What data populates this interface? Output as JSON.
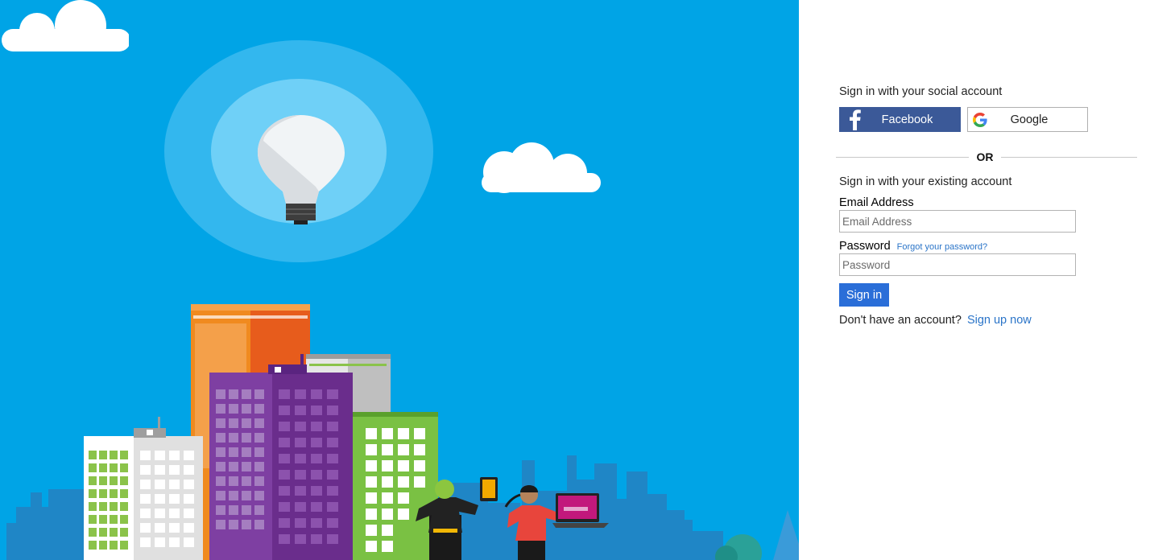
{
  "social": {
    "heading": "Sign in with your social account",
    "facebook_label": "Facebook",
    "google_label": "Google"
  },
  "divider": {
    "label": "OR"
  },
  "local": {
    "heading": "Sign in with your existing account",
    "email_label": "Email Address",
    "email_placeholder": "Email Address",
    "email_value": "",
    "password_label": "Password",
    "forgot_link": "Forgot your password?",
    "password_placeholder": "Password",
    "password_value": "",
    "signin_label": "Sign in"
  },
  "signup": {
    "prompt": "Don't have an account?",
    "link": "Sign up now"
  },
  "colors": {
    "hero_background": "#00a4e6",
    "facebook": "#3b5998",
    "primary_button": "#2a6ed8",
    "link": "#2a74c8"
  },
  "icons": {
    "facebook": "facebook-icon",
    "google": "google-icon"
  }
}
